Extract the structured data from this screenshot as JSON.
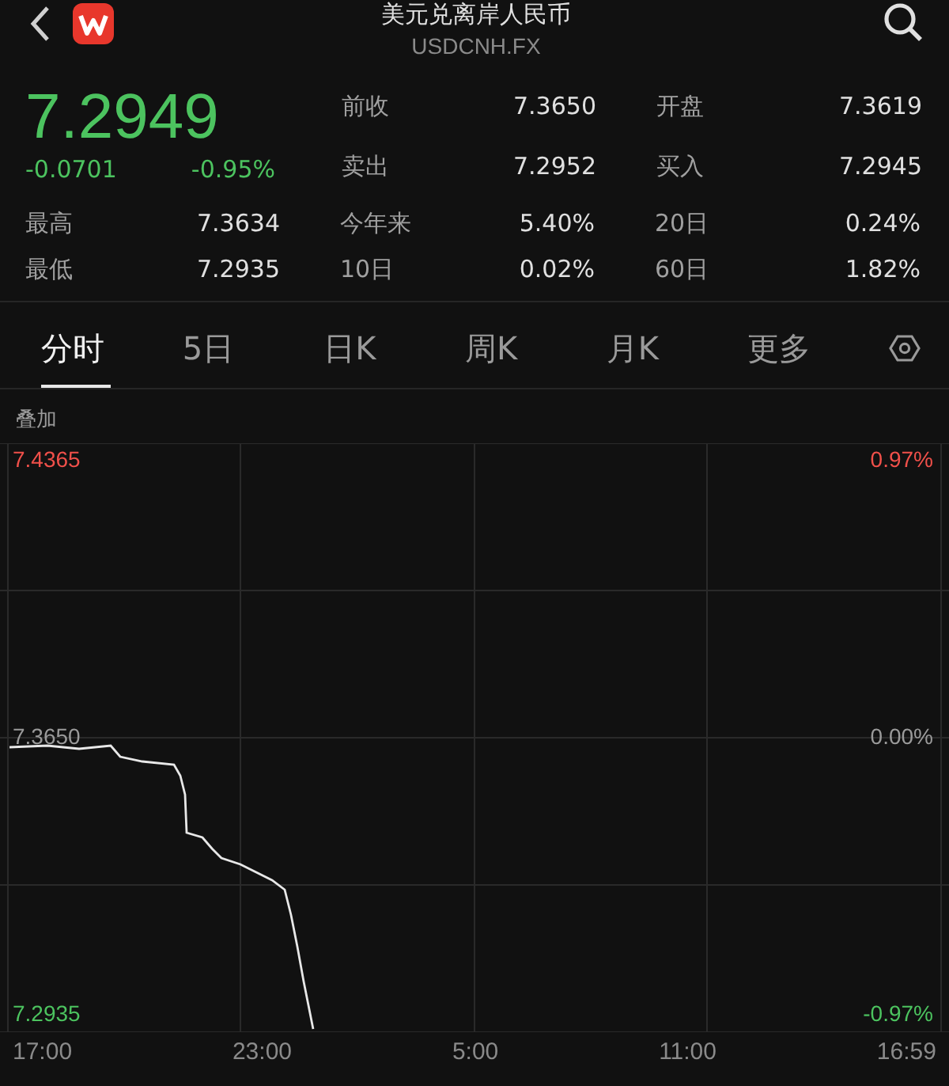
{
  "header": {
    "title": "美元兑离岸人民币",
    "code": "USDCNH.FX"
  },
  "quote": {
    "price": "7.2949",
    "change": "-0.0701",
    "change_pct": "-0.95%",
    "falling": true
  },
  "stats": [
    [
      {
        "label": "前收",
        "value": "7.3650"
      },
      {
        "label": "开盘",
        "value": "7.3619"
      }
    ],
    [
      {
        "label": "卖出",
        "value": "7.2952"
      },
      {
        "label": "买入",
        "value": "7.2945"
      }
    ]
  ],
  "stats_more": [
    [
      {
        "label": "最高",
        "value": "7.3634"
      },
      {
        "label": "今年来",
        "value": "5.40%"
      },
      {
        "label": "20日",
        "value": "0.24%"
      }
    ],
    [
      {
        "label": "最低",
        "value": "7.2935"
      },
      {
        "label": "10日",
        "value": "0.02%"
      },
      {
        "label": "60日",
        "value": "1.82%"
      }
    ]
  ],
  "tabs": [
    {
      "label": "分时",
      "selected": true
    },
    {
      "label": "5日",
      "selected": false
    },
    {
      "label": "日K",
      "selected": false
    },
    {
      "label": "周K",
      "selected": false
    },
    {
      "label": "月K",
      "selected": false
    },
    {
      "label": "更多",
      "selected": false
    }
  ],
  "overlay_label": "叠加",
  "chart_levels": [
    {
      "price": "7.4365",
      "percent": "0.97%",
      "kind": "up"
    },
    {
      "price": "7.3650",
      "percent": "0.00%",
      "kind": "flat"
    },
    {
      "price": "7.2935",
      "percent": "-0.97%",
      "kind": "down"
    }
  ],
  "time_labels": [
    "17:00",
    "23:00",
    "5:00",
    "11:00",
    "16:59"
  ]
}
